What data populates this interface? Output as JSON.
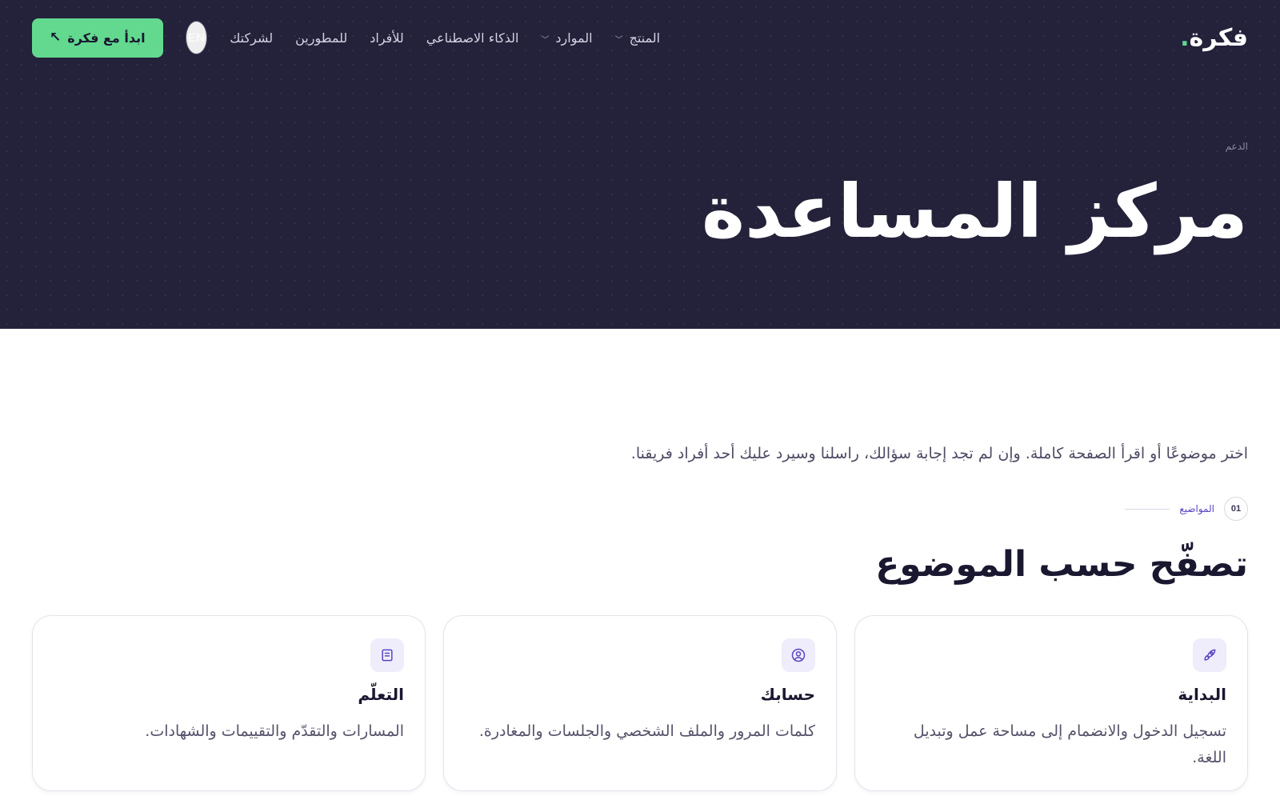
{
  "nav": {
    "logo": "فكرة",
    "logo_dot": ".",
    "links": [
      {
        "label": "المنتج",
        "dropdown": true
      },
      {
        "label": "الموارد",
        "dropdown": true
      },
      {
        "label": "الذكاء الاصطناعي",
        "dropdown": false
      },
      {
        "label": "للأفراد",
        "dropdown": false
      },
      {
        "label": "للمطورين",
        "dropdown": false
      },
      {
        "label": "لشركتك",
        "dropdown": false
      }
    ],
    "lang_toggle": "EN",
    "cta_label": "ابدأ مع فكرة",
    "cta_icon": "↖"
  },
  "hero": {
    "breadcrumb": "الدعم",
    "title": "مركز المساعدة"
  },
  "intro": "اختر موضوعًا أو اقرأ الصفحة كاملة. وإن لم تجد إجابة سؤالك، راسلنا وسيرد عليك أحد أفراد فريقنا.",
  "section": {
    "number": "01",
    "label": "المواضيع",
    "title": "تصفّح حسب الموضوع"
  },
  "cards": [
    {
      "icon": "rocket-icon",
      "title": "البداية",
      "desc": "تسجيل الدخول والانضمام إلى مساحة عمل وتبديل اللغة."
    },
    {
      "icon": "user-circle-icon",
      "title": "حسابك",
      "desc": "كلمات المرور والملف الشخصي والجلسات والمغادرة."
    },
    {
      "icon": "book-icon",
      "title": "التعلّم",
      "desc": "المسارات والتقدّم والتقييمات والشهادات."
    }
  ],
  "colors": {
    "hero_bg": "#24213a",
    "accent_green": "#62d98f",
    "accent_purple": "#5746c4",
    "icon_bg": "#efedfb"
  }
}
